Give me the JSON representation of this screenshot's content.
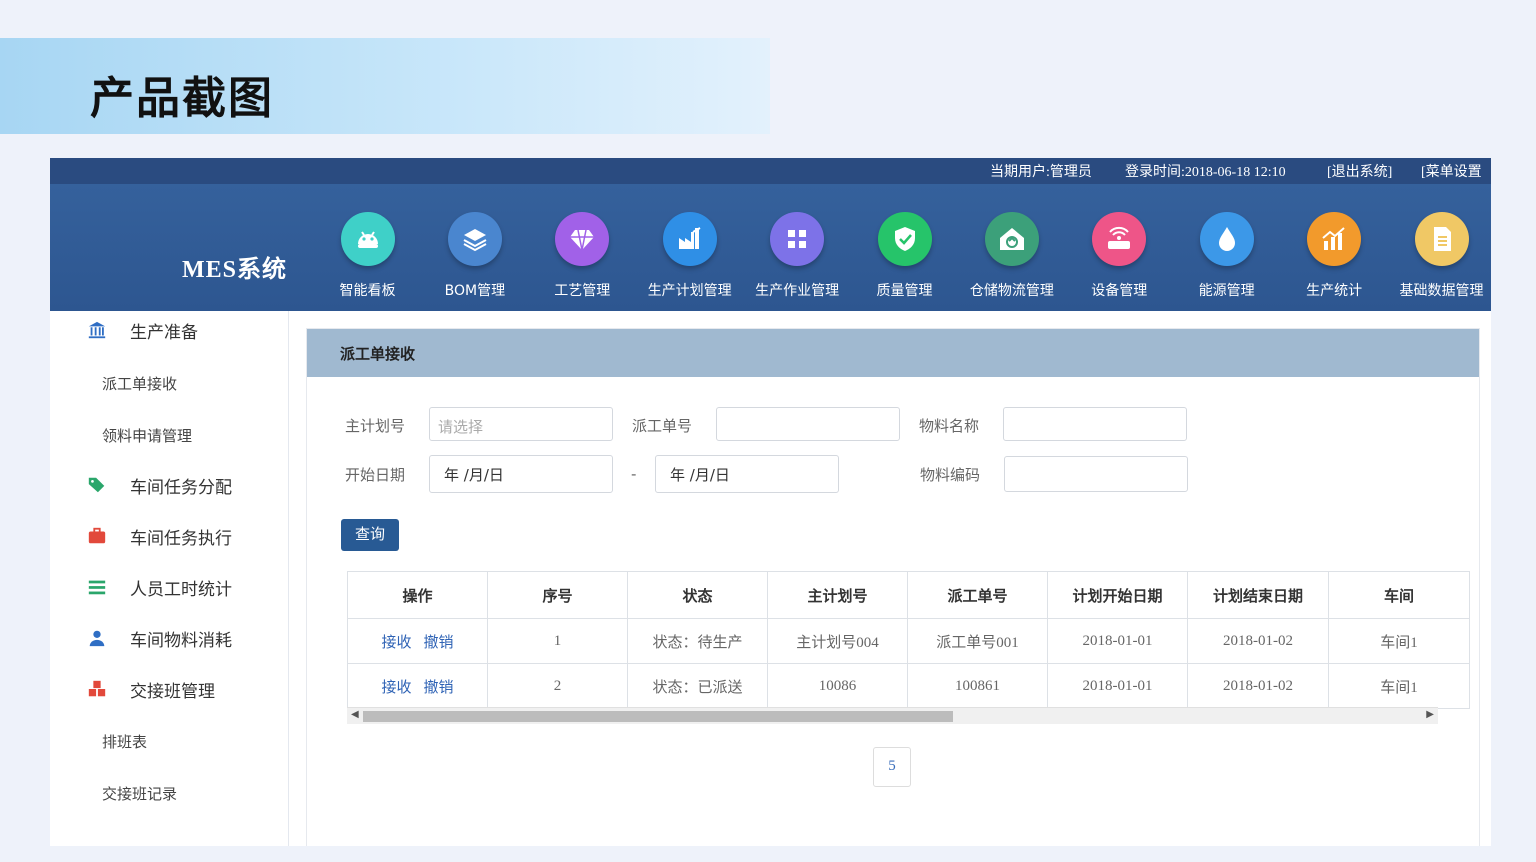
{
  "page_title": "产品截图",
  "topbar": {
    "user": "当期用户:管理员",
    "login_time": "登录时间:2018-06-18 12:10",
    "logout": "[退出系统]",
    "menu_settings": "[菜单设置"
  },
  "brand": "MES系统",
  "nav": [
    {
      "label": "智能看板",
      "icon": "android-icon",
      "color": "#3fd0c8"
    },
    {
      "label": "BOM管理",
      "icon": "layers-icon",
      "color": "#4a86cf"
    },
    {
      "label": "工艺管理",
      "icon": "diamond-icon",
      "color": "#a161e8"
    },
    {
      "label": "生产计划管理",
      "icon": "factory-icon",
      "color": "#2f8fe6"
    },
    {
      "label": "生产作业管理",
      "icon": "grid-icon",
      "color": "#7d72e8"
    },
    {
      "label": "质量管理",
      "icon": "shield-check-icon",
      "color": "#26c46a"
    },
    {
      "label": "仓储物流管理",
      "icon": "warehouse-icon",
      "color": "#3ca07a"
    },
    {
      "label": "设备管理",
      "icon": "router-icon",
      "color": "#ee5588"
    },
    {
      "label": "能源管理",
      "icon": "droplet-icon",
      "color": "#3c98e8"
    },
    {
      "label": "生产统计",
      "icon": "chart-icon",
      "color": "#f29a2c"
    },
    {
      "label": "基础数据管理",
      "icon": "document-icon",
      "color": "#f0c865"
    }
  ],
  "sidebar": {
    "items": [
      {
        "label": "生产准备",
        "icon": "bank-icon",
        "color": "#2f6ec4"
      },
      {
        "label": "派工单接收",
        "sub": true
      },
      {
        "label": "领料申请管理",
        "sub": true
      },
      {
        "label": "车间任务分配",
        "icon": "tag-icon",
        "color": "#2aa66b"
      },
      {
        "label": "车间任务执行",
        "icon": "briefcase-icon",
        "color": "#e2493b"
      },
      {
        "label": "人员工时统计",
        "icon": "list-icon",
        "color": "#2aa66b"
      },
      {
        "label": "车间物料消耗",
        "icon": "user-icon",
        "color": "#2f6ec4"
      },
      {
        "label": "交接班管理",
        "icon": "cubes-icon",
        "color": "#e2493b"
      },
      {
        "label": "排班表",
        "sub": true
      },
      {
        "label": "交接班记录",
        "sub": true
      }
    ]
  },
  "panel": {
    "title": "派工单接收",
    "form": {
      "main_plan_label": "主计划号",
      "main_plan_placeholder": "请选择",
      "dispatch_no_label": "派工单号",
      "material_name_label": "物料名称",
      "start_date_label": "开始日期",
      "date_from": "年 /月/日",
      "date_sep": "-",
      "date_to": "年 /月/日",
      "material_code_label": "物料编码",
      "query_button": "查询"
    },
    "table": {
      "columns": [
        "操作",
        "序号",
        "状态",
        "主计划号",
        "派工单号",
        "计划开始日期",
        "计划结束日期",
        "车间"
      ],
      "actions": {
        "accept": "接收",
        "revoke": "撤销"
      },
      "rows": [
        {
          "seq": "1",
          "status": "状态：待生产",
          "main_plan": "主计划号004",
          "dispatch_no": "派工单号001",
          "start": "2018-01-01",
          "end": "2018-01-02",
          "workshop": "车间1"
        },
        {
          "seq": "2",
          "status": "状态：已派送",
          "main_plan": "10086",
          "dispatch_no": "100861",
          "start": "2018-01-01",
          "end": "2018-01-02",
          "workshop": "车间1"
        }
      ]
    },
    "pager": "5"
  }
}
